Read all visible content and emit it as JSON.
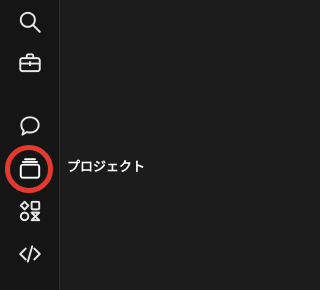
{
  "sidebar": {
    "items": [
      {
        "id": "search",
        "icon": "search-icon"
      },
      {
        "id": "briefcase",
        "icon": "briefcase-icon"
      },
      {
        "id": "chat",
        "icon": "chat-bubble-icon"
      },
      {
        "id": "projects",
        "icon": "project-folder-icon",
        "active": true
      },
      {
        "id": "components",
        "icon": "shapes-icon"
      },
      {
        "id": "code",
        "icon": "code-icon"
      }
    ]
  },
  "tooltip": {
    "label": "プロジェクト"
  },
  "colors": {
    "background": "#1c1c1c",
    "sidebar": "#151515",
    "icon": "#e6e6e6",
    "highlight_ring": "#e23a2e",
    "tooltip_text": "#ffffff"
  }
}
